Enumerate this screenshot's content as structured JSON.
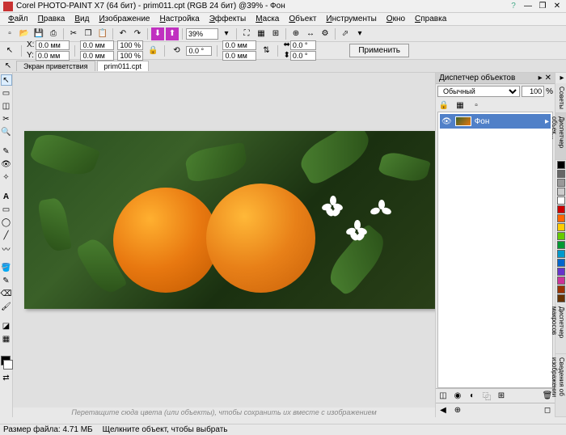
{
  "title": "Corel PHOTO-PAINT X7 (64 бит) - prim011.cpt (RGB 24 бит) @39% - Фон",
  "menu": [
    "Файл",
    "Правка",
    "Вид",
    "Изображение",
    "Настройка",
    "Эффекты",
    "Маска",
    "Объект",
    "Инструменты",
    "Окно",
    "Справка"
  ],
  "zoom": "39%",
  "coords": {
    "x_label": "X:",
    "y_label": "Y:",
    "x": "0.0 мм",
    "y": "0.0 мм",
    "w": "0.0 мм",
    "h": "0.0 мм",
    "sx": "100 %",
    "sy": "100 %",
    "rot": "0.0 °",
    "dx": "0.0 мм",
    "dy": "0.0 мм",
    "r2": "0.0 °",
    "r3": "0.0 °"
  },
  "apply": "Применить",
  "tabs": {
    "welcome": "Экран приветствия",
    "doc": "prim011.cpt"
  },
  "panel": {
    "title": "Диспетчер объектов",
    "blend": "Обычный",
    "opacity": "100",
    "pct": "%",
    "layer": "Фон"
  },
  "strip_tabs": [
    "Советы",
    "Диспетчер объек...",
    "Диспетчер макросов",
    "Сведения об изображении"
  ],
  "palette": [
    "#000000",
    "#666666",
    "#999999",
    "#cccccc",
    "#ffffff",
    "#cc0000",
    "#ff6600",
    "#ffcc00",
    "#66cc00",
    "#009933",
    "#0099cc",
    "#0066cc",
    "#6633cc",
    "#cc3399",
    "#993300",
    "#663300"
  ],
  "hint": "Перетащите сюда цвета (или объекты), чтобы сохранить их вместе с изображением",
  "status": {
    "size_label": "Размер файла:",
    "size": "4.71 МБ",
    "tip": "Щелкните объект, чтобы выбрать"
  }
}
